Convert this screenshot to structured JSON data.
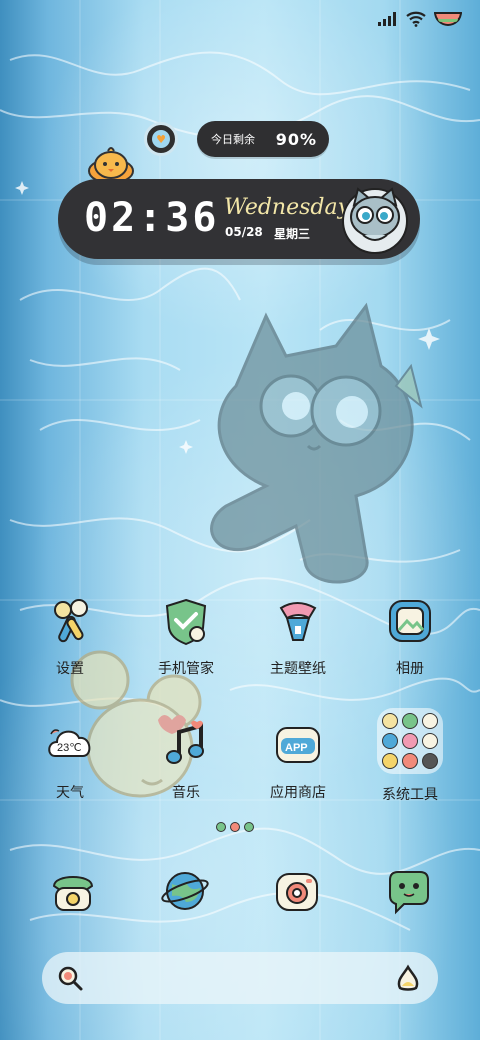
{
  "status_bar": {
    "icons": [
      "signal-icon",
      "wifi-icon",
      "battery-icon"
    ]
  },
  "battery_widget": {
    "label": "今日剩余",
    "percent": "90%"
  },
  "clock_widget": {
    "time": "02:36",
    "weekday": "Wednesday",
    "date": "05/28",
    "weekday_zh": "星期三"
  },
  "apps_row1": [
    {
      "label": "设置",
      "icon": "settings-icon"
    },
    {
      "label": "手机管家",
      "icon": "phone-manager-icon"
    },
    {
      "label": "主题壁纸",
      "icon": "theme-wallpaper-icon"
    },
    {
      "label": "相册",
      "icon": "gallery-icon"
    }
  ],
  "apps_row2": [
    {
      "label": "天气",
      "icon": "weather-icon",
      "badge": "23℃"
    },
    {
      "label": "音乐",
      "icon": "music-icon"
    },
    {
      "label": "应用商店",
      "icon": "app-store-icon",
      "badge": "APP"
    },
    {
      "label": "系统工具",
      "icon": "folder-icon"
    }
  ],
  "dock": [
    "phone-icon",
    "browser-icon",
    "camera-icon",
    "messages-icon"
  ],
  "search_bar": {
    "icons": [
      "search-icon",
      "assistant-icon"
    ]
  },
  "colors": {
    "widget_dark": "#323235",
    "weekday_text": "#f2e6a8",
    "water": "#a9dcf2"
  }
}
